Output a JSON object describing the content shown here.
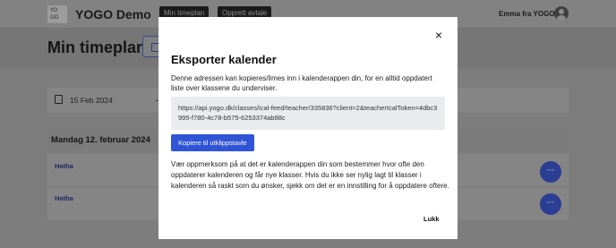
{
  "header": {
    "logo_text": "YO GO",
    "brand": "YOGO Demo",
    "nav": [
      "Min timeplan",
      "Opprett avtale"
    ],
    "user_name": "Emma fra YOGO"
  },
  "page": {
    "title": "Min timeplan",
    "date": "15 Feb 2024",
    "prev_arrow": "←",
    "day_header": "Mandag 12. februar 2024",
    "rows": [
      {
        "label": "Hatha",
        "menu": "···"
      },
      {
        "label": "Hatha",
        "menu": "···"
      }
    ]
  },
  "modal": {
    "close": "×",
    "title": "Eksporter kalender",
    "description": "Denne adressen kan kopieres/limes inn i kalenderappen din, for en alltid oppdatert liste over klassene du underviser.",
    "url": "https://api.yogo.dk/classes/ical-feed/teacher/335836?client=2&teacherIcalToken=4dbc3995-f780-4c78-b575-6253374ab88c",
    "copy_button": "Kopiere til utklippstavle",
    "note": "Vær oppmerksom på at det er kalenderappen din som bestemmer hvor ofte den oppdaterer kalenderen og får nye klasser. Hvis du ikke ser nylig lagt til klasser i kalenderen så raskt som du ønsker, sjekk om det er en innstilling for å oppdatere oftere.",
    "close_button": "Lukk"
  },
  "colors": {
    "overlay": "#7d7d7d",
    "primary": "#2f54d6",
    "modal_bg": "#ffffff",
    "url_box_bg": "#e9ebef"
  }
}
